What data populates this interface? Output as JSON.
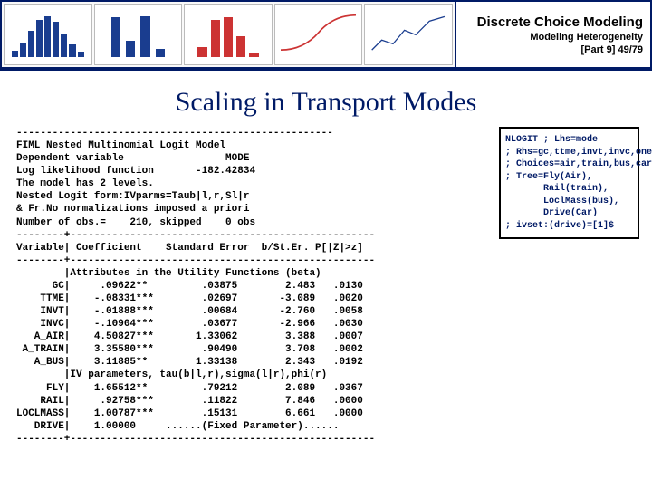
{
  "header": {
    "title1": "Discrete Choice Modeling",
    "title2": "Modeling Heterogeneity",
    "part": "[Part 9]  49/79"
  },
  "mainTitle": "Scaling in Transport Modes",
  "output": "-----------------------------------------------------\nFIML Nested Multinomial Logit Model\nDependent variable                 MODE\nLog likelihood function       -182.42834\nThe model has 2 levels.\nNested Logit form:IVparms=Taub|l,r,Sl|r\n& Fr.No normalizations imposed a priori\nNumber of obs.=    210, skipped    0 obs\n--------+---------------------------------------------------\nVariable| Coefficient    Standard Error  b/St.Er. P[|Z|>z]\n--------+---------------------------------------------------\n        |Attributes in the Utility Functions (beta)\n      GC|     .09622**         .03875        2.483   .0130\n    TTME|    -.08331***        .02697       -3.089   .0020\n    INVT|    -.01888***        .00684       -2.760   .0058\n    INVC|    -.10904***        .03677       -2.966   .0030\n   A_AIR|    4.50827***       1.33062        3.388   .0007\n A_TRAIN|    3.35580***        .90490        3.708   .0002\n   A_BUS|    3.11885**        1.33138        2.343   .0192\n        |IV parameters, tau(b|l,r),sigma(l|r),phi(r)\n     FLY|    1.65512**         .79212        2.089   .0367\n    RAIL|     .92758***        .11822        7.846   .0000\nLOCLMASS|    1.00787***        .15131        6.661   .0000\n   DRIVE|    1.00000     ......(Fixed Parameter)......\n--------+---------------------------------------------------",
  "code": "NLOGIT ; Lhs=mode\n; Rhs=gc,ttme,invt,invc,one\n; Choices=air,train,bus,car\n; Tree=Fly(Air),\n       Rail(train),\n       LoclMass(bus),\n       Drive(Car)\n; ivset:(drive)=[1]$"
}
